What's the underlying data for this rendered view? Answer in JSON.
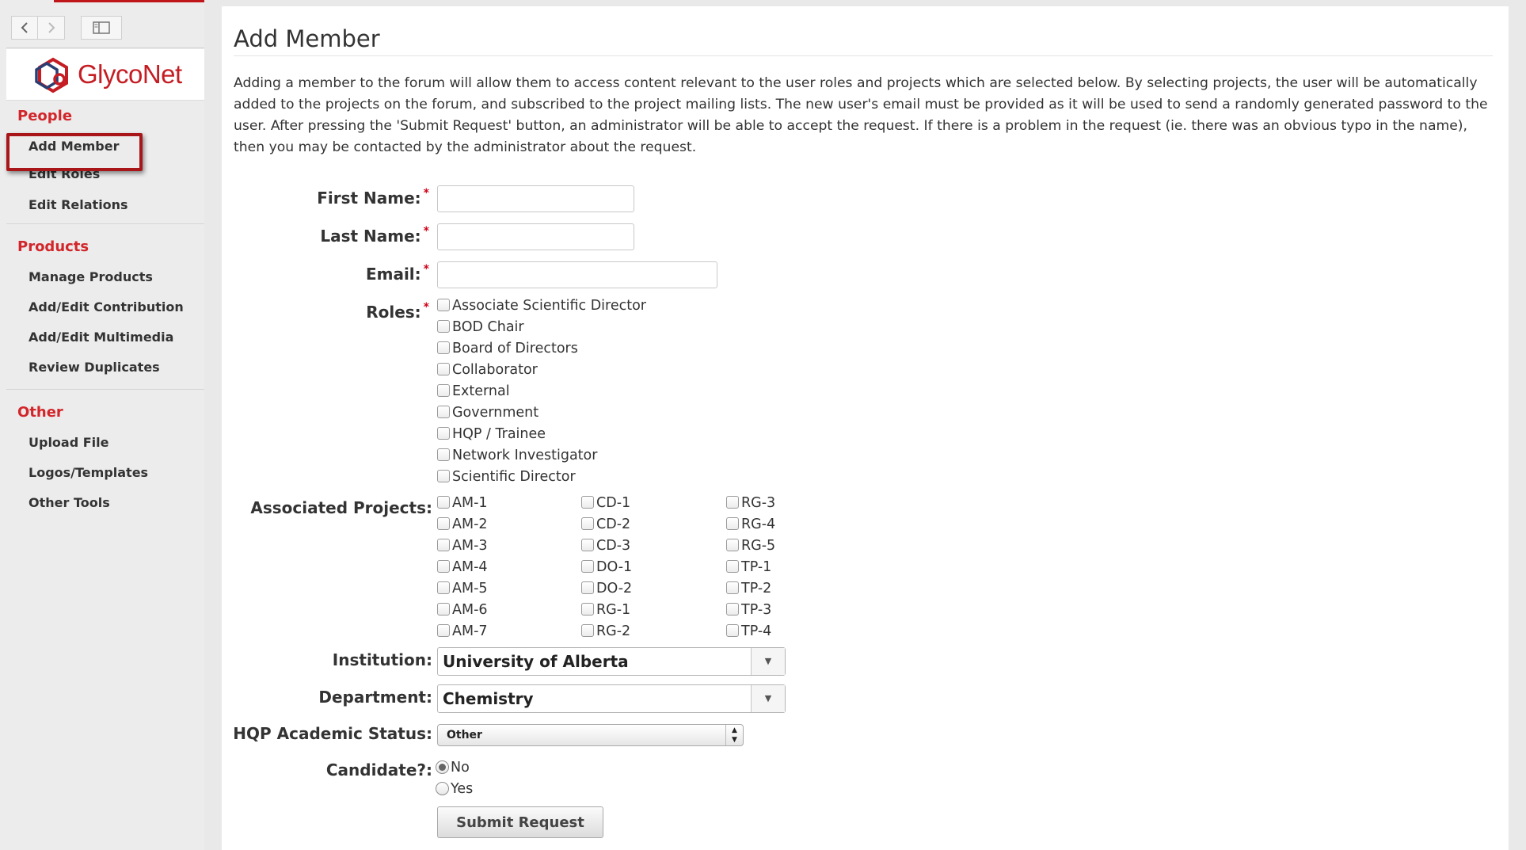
{
  "app": {
    "logo_text": "GlycoNet",
    "brand_color": "#c41d23"
  },
  "navbar": {
    "back_icon": "chevron-left-icon",
    "forward_icon": "chevron-right-icon",
    "sidebar_toggle_icon": "sidebar-icon"
  },
  "sidebar": {
    "sections": [
      {
        "title": "People",
        "items": [
          "Add Member",
          "Edit Roles",
          "Edit Relations"
        ]
      },
      {
        "title": "Products",
        "items": [
          "Manage Products",
          "Add/Edit Contribution",
          "Add/Edit Multimedia",
          "Review Duplicates"
        ]
      },
      {
        "title": "Other",
        "items": [
          "Upload File",
          "Logos/Templates",
          "Other Tools"
        ]
      }
    ]
  },
  "page": {
    "title": "Add Member",
    "intro": "Adding a member to the forum will allow them to access content relevant to the user roles and projects which are selected below. By selecting projects, the user will be automatically added to the projects on the forum, and subscribed to the project mailing lists. The new user's email must be provided as it will be used to send a randomly generated password to the user. After pressing the 'Submit Request' button, an administrator will be able to accept the request. If there is a problem in the request (ie. there was an obvious typo in the name), then you may be contacted by the administrator about the request."
  },
  "form": {
    "required_mark": "*",
    "first_name": {
      "label": "First Name:",
      "value": ""
    },
    "last_name": {
      "label": "Last Name:",
      "value": ""
    },
    "email": {
      "label": "Email:",
      "value": ""
    },
    "roles": {
      "label": "Roles:",
      "options": [
        "Associate Scientific Director",
        "BOD Chair",
        "Board of Directors",
        "Collaborator",
        "External",
        "Government",
        "HQP / Trainee",
        "Network Investigator",
        "Scientific Director"
      ]
    },
    "projects": {
      "label": "Associated Projects:",
      "columns": [
        [
          "AM-1",
          "AM-2",
          "AM-3",
          "AM-4",
          "AM-5",
          "AM-6",
          "AM-7"
        ],
        [
          "CD-1",
          "CD-2",
          "CD-3",
          "DO-1",
          "DO-2",
          "RG-1",
          "RG-2"
        ],
        [
          "RG-3",
          "RG-4",
          "RG-5",
          "TP-1",
          "TP-2",
          "TP-3",
          "TP-4"
        ]
      ]
    },
    "institution": {
      "label": "Institution:",
      "value": "University of Alberta"
    },
    "department": {
      "label": "Department:",
      "value": "Chemistry"
    },
    "hqp_status": {
      "label": "HQP Academic Status:",
      "value": "Other"
    },
    "candidate": {
      "label": "Candidate?:",
      "options": [
        "No",
        "Yes"
      ],
      "selected": "No"
    },
    "submit_label": "Submit Request"
  }
}
